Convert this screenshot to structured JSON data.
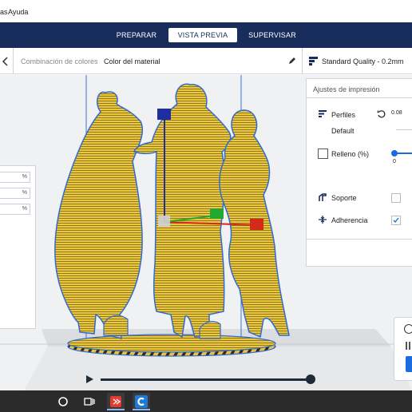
{
  "menu": {
    "item_1": "as",
    "item_2": "Ayuda"
  },
  "nav": {
    "tabs": [
      {
        "label": "PREPARAR",
        "active": false
      },
      {
        "label": "VISTA PREVIA",
        "active": true
      },
      {
        "label": "SUPERVISAR",
        "active": false
      }
    ]
  },
  "toolbar": {
    "color_scheme_label": "Combinación de colores",
    "color_scheme_value": "Color del material",
    "quality_profile": "Standard Quality - 0.2mm"
  },
  "left_panel": {
    "field_units": [
      "%",
      "%",
      "%"
    ]
  },
  "print_settings": {
    "title": "Ajustes de impresión",
    "profiles_label": "Perfiles",
    "profiles_value": "Default",
    "layer_height": "0.08",
    "infill_label": "Relleno (%)",
    "infill_value": "0",
    "infill_checked": false,
    "support_label": "Soporte",
    "support_checked": false,
    "adhesion_label": "Adherencia",
    "adhesion_checked": true
  },
  "colors": {
    "nav_bg": "#192d5d",
    "accent_blue": "#1a6de0",
    "model_yellow": "#ebc23a",
    "outline_blue": "#2e6bd6"
  },
  "icons": {
    "back": "chevron-left-icon",
    "edit": "pencil-icon",
    "quality": "quality-bars-icon",
    "profiles": "profiles-icon",
    "reset": "undo-icon",
    "support": "support-icon",
    "adhesion": "adhesion-icon",
    "play": "play-icon"
  }
}
